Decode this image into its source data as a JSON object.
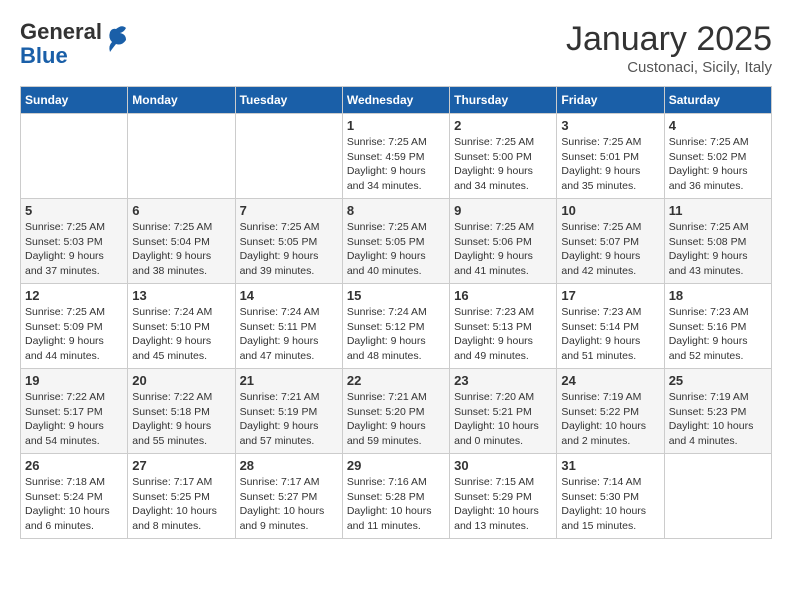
{
  "logo": {
    "general": "General",
    "blue": "Blue"
  },
  "title": "January 2025",
  "location": "Custonaci, Sicily, Italy",
  "days_of_week": [
    "Sunday",
    "Monday",
    "Tuesday",
    "Wednesday",
    "Thursday",
    "Friday",
    "Saturday"
  ],
  "weeks": [
    [
      {
        "day": "",
        "info": ""
      },
      {
        "day": "",
        "info": ""
      },
      {
        "day": "",
        "info": ""
      },
      {
        "day": "1",
        "info": "Sunrise: 7:25 AM\nSunset: 4:59 PM\nDaylight: 9 hours\nand 34 minutes."
      },
      {
        "day": "2",
        "info": "Sunrise: 7:25 AM\nSunset: 5:00 PM\nDaylight: 9 hours\nand 34 minutes."
      },
      {
        "day": "3",
        "info": "Sunrise: 7:25 AM\nSunset: 5:01 PM\nDaylight: 9 hours\nand 35 minutes."
      },
      {
        "day": "4",
        "info": "Sunrise: 7:25 AM\nSunset: 5:02 PM\nDaylight: 9 hours\nand 36 minutes."
      }
    ],
    [
      {
        "day": "5",
        "info": "Sunrise: 7:25 AM\nSunset: 5:03 PM\nDaylight: 9 hours\nand 37 minutes."
      },
      {
        "day": "6",
        "info": "Sunrise: 7:25 AM\nSunset: 5:04 PM\nDaylight: 9 hours\nand 38 minutes."
      },
      {
        "day": "7",
        "info": "Sunrise: 7:25 AM\nSunset: 5:05 PM\nDaylight: 9 hours\nand 39 minutes."
      },
      {
        "day": "8",
        "info": "Sunrise: 7:25 AM\nSunset: 5:05 PM\nDaylight: 9 hours\nand 40 minutes."
      },
      {
        "day": "9",
        "info": "Sunrise: 7:25 AM\nSunset: 5:06 PM\nDaylight: 9 hours\nand 41 minutes."
      },
      {
        "day": "10",
        "info": "Sunrise: 7:25 AM\nSunset: 5:07 PM\nDaylight: 9 hours\nand 42 minutes."
      },
      {
        "day": "11",
        "info": "Sunrise: 7:25 AM\nSunset: 5:08 PM\nDaylight: 9 hours\nand 43 minutes."
      }
    ],
    [
      {
        "day": "12",
        "info": "Sunrise: 7:25 AM\nSunset: 5:09 PM\nDaylight: 9 hours\nand 44 minutes."
      },
      {
        "day": "13",
        "info": "Sunrise: 7:24 AM\nSunset: 5:10 PM\nDaylight: 9 hours\nand 45 minutes."
      },
      {
        "day": "14",
        "info": "Sunrise: 7:24 AM\nSunset: 5:11 PM\nDaylight: 9 hours\nand 47 minutes."
      },
      {
        "day": "15",
        "info": "Sunrise: 7:24 AM\nSunset: 5:12 PM\nDaylight: 9 hours\nand 48 minutes."
      },
      {
        "day": "16",
        "info": "Sunrise: 7:23 AM\nSunset: 5:13 PM\nDaylight: 9 hours\nand 49 minutes."
      },
      {
        "day": "17",
        "info": "Sunrise: 7:23 AM\nSunset: 5:14 PM\nDaylight: 9 hours\nand 51 minutes."
      },
      {
        "day": "18",
        "info": "Sunrise: 7:23 AM\nSunset: 5:16 PM\nDaylight: 9 hours\nand 52 minutes."
      }
    ],
    [
      {
        "day": "19",
        "info": "Sunrise: 7:22 AM\nSunset: 5:17 PM\nDaylight: 9 hours\nand 54 minutes."
      },
      {
        "day": "20",
        "info": "Sunrise: 7:22 AM\nSunset: 5:18 PM\nDaylight: 9 hours\nand 55 minutes."
      },
      {
        "day": "21",
        "info": "Sunrise: 7:21 AM\nSunset: 5:19 PM\nDaylight: 9 hours\nand 57 minutes."
      },
      {
        "day": "22",
        "info": "Sunrise: 7:21 AM\nSunset: 5:20 PM\nDaylight: 9 hours\nand 59 minutes."
      },
      {
        "day": "23",
        "info": "Sunrise: 7:20 AM\nSunset: 5:21 PM\nDaylight: 10 hours\nand 0 minutes."
      },
      {
        "day": "24",
        "info": "Sunrise: 7:19 AM\nSunset: 5:22 PM\nDaylight: 10 hours\nand 2 minutes."
      },
      {
        "day": "25",
        "info": "Sunrise: 7:19 AM\nSunset: 5:23 PM\nDaylight: 10 hours\nand 4 minutes."
      }
    ],
    [
      {
        "day": "26",
        "info": "Sunrise: 7:18 AM\nSunset: 5:24 PM\nDaylight: 10 hours\nand 6 minutes."
      },
      {
        "day": "27",
        "info": "Sunrise: 7:17 AM\nSunset: 5:25 PM\nDaylight: 10 hours\nand 8 minutes."
      },
      {
        "day": "28",
        "info": "Sunrise: 7:17 AM\nSunset: 5:27 PM\nDaylight: 10 hours\nand 9 minutes."
      },
      {
        "day": "29",
        "info": "Sunrise: 7:16 AM\nSunset: 5:28 PM\nDaylight: 10 hours\nand 11 minutes."
      },
      {
        "day": "30",
        "info": "Sunrise: 7:15 AM\nSunset: 5:29 PM\nDaylight: 10 hours\nand 13 minutes."
      },
      {
        "day": "31",
        "info": "Sunrise: 7:14 AM\nSunset: 5:30 PM\nDaylight: 10 hours\nand 15 minutes."
      },
      {
        "day": "",
        "info": ""
      }
    ]
  ]
}
